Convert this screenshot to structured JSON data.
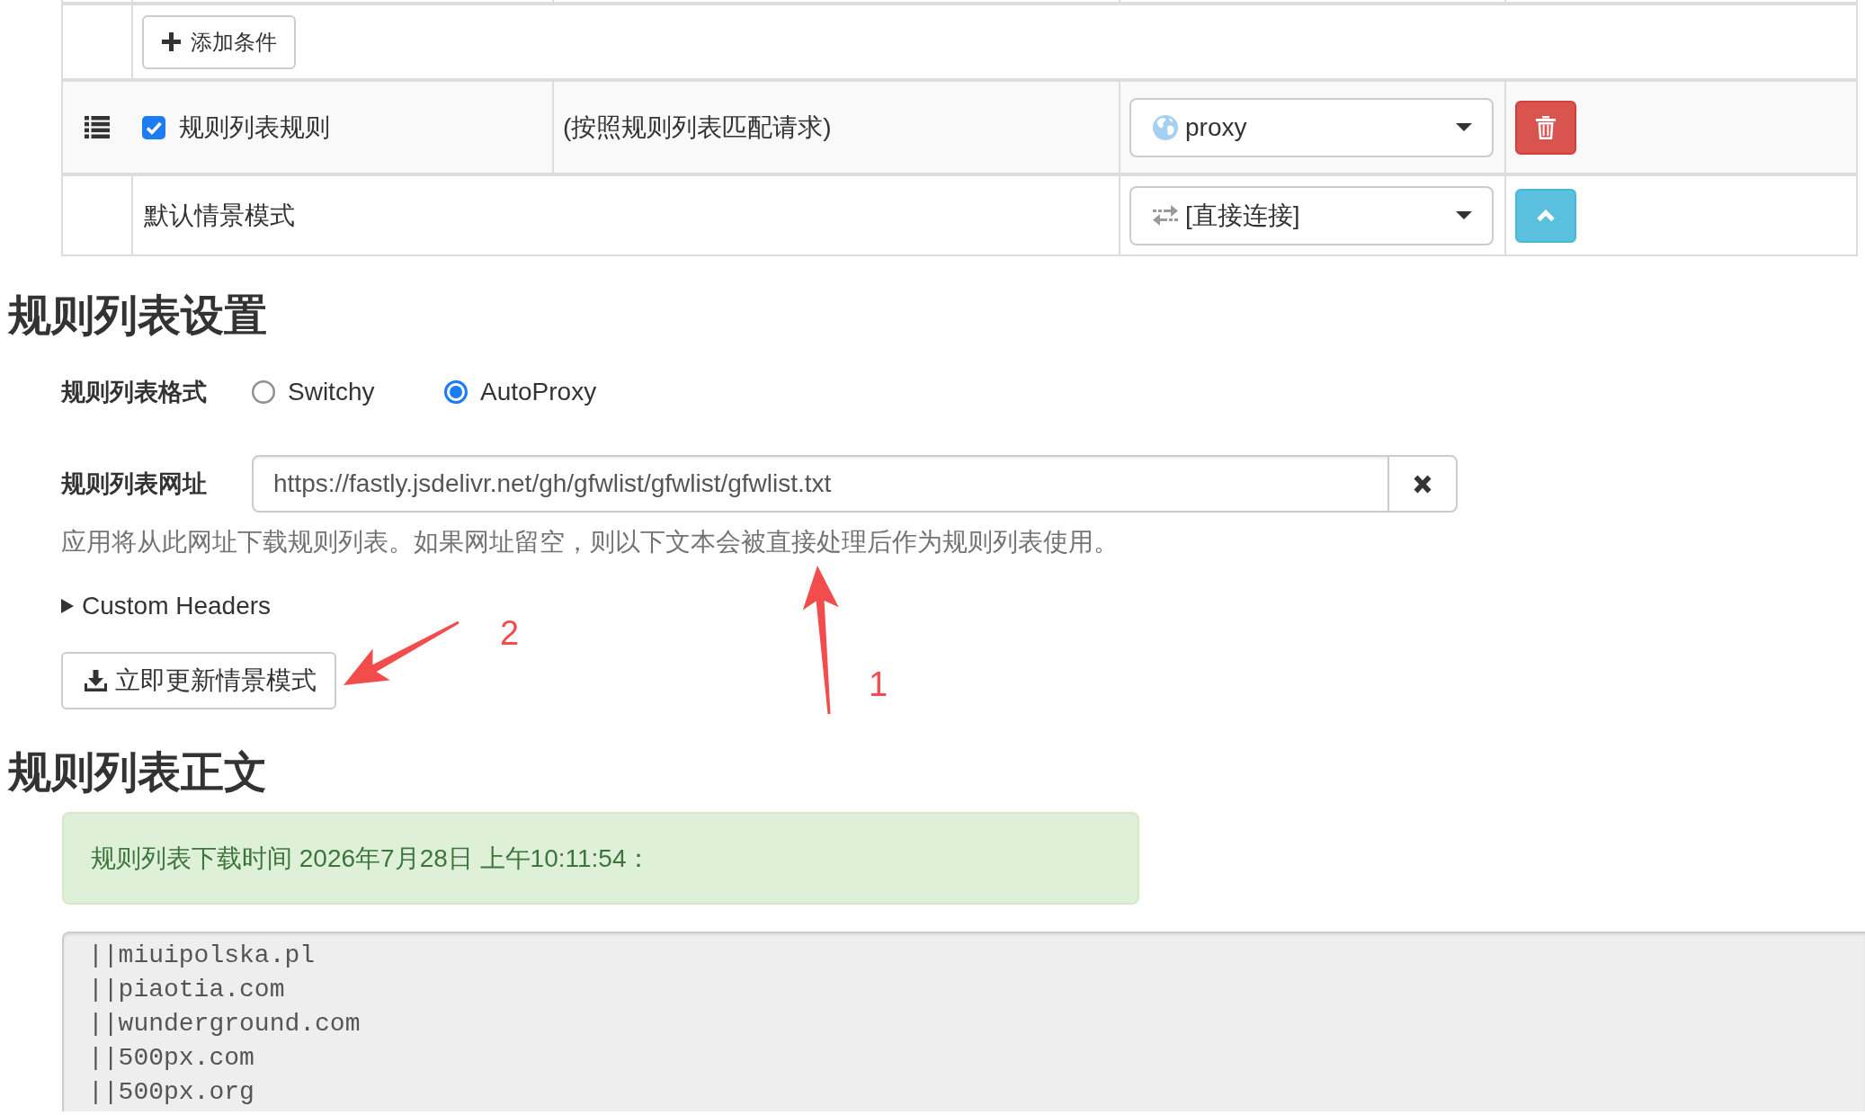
{
  "rules_table": {
    "add_condition_button": {
      "label": "添加条件"
    },
    "rows": [
      {
        "kind": "rule",
        "checked": true,
        "condition_type": "规则列表规则",
        "details": "(按照规则列表匹配请求)",
        "profile": {
          "kind": "proxy",
          "label": "proxy"
        }
      },
      {
        "kind": "default",
        "label": "默认情景模式",
        "profile": {
          "kind": "direct",
          "label": "[直接连接]"
        }
      }
    ]
  },
  "rule_list_settings": {
    "heading": "规则列表设置",
    "format": {
      "label": "规则列表格式",
      "options": [
        {
          "label": "Switchy",
          "selected": false
        },
        {
          "label": "AutoProxy",
          "selected": true
        }
      ]
    },
    "url": {
      "label": "规则列表网址",
      "value": "https://fastly.jsdelivr.net/gh/gfwlist/gfwlist/gfwlist.txt"
    },
    "help": "应用将从此网址下载规则列表。如果网址留空，则以下文本会被直接处理后作为规则列表使用。",
    "custom_headers": {
      "label": "Custom Headers",
      "expanded": false
    },
    "update_button": {
      "label": "立即更新情景模式"
    }
  },
  "rule_list_text": {
    "heading": "规则列表正文",
    "notice": "规则列表下载时间 2026年7月28日 上午10:11:54：",
    "lines": [
      "||miuipolska.pl",
      "||piaotia.com",
      "||wunderground.com",
      "||500px.com",
      "||500px.org"
    ]
  },
  "annotations": [
    {
      "label": "1"
    },
    {
      "label": "2"
    }
  ]
}
